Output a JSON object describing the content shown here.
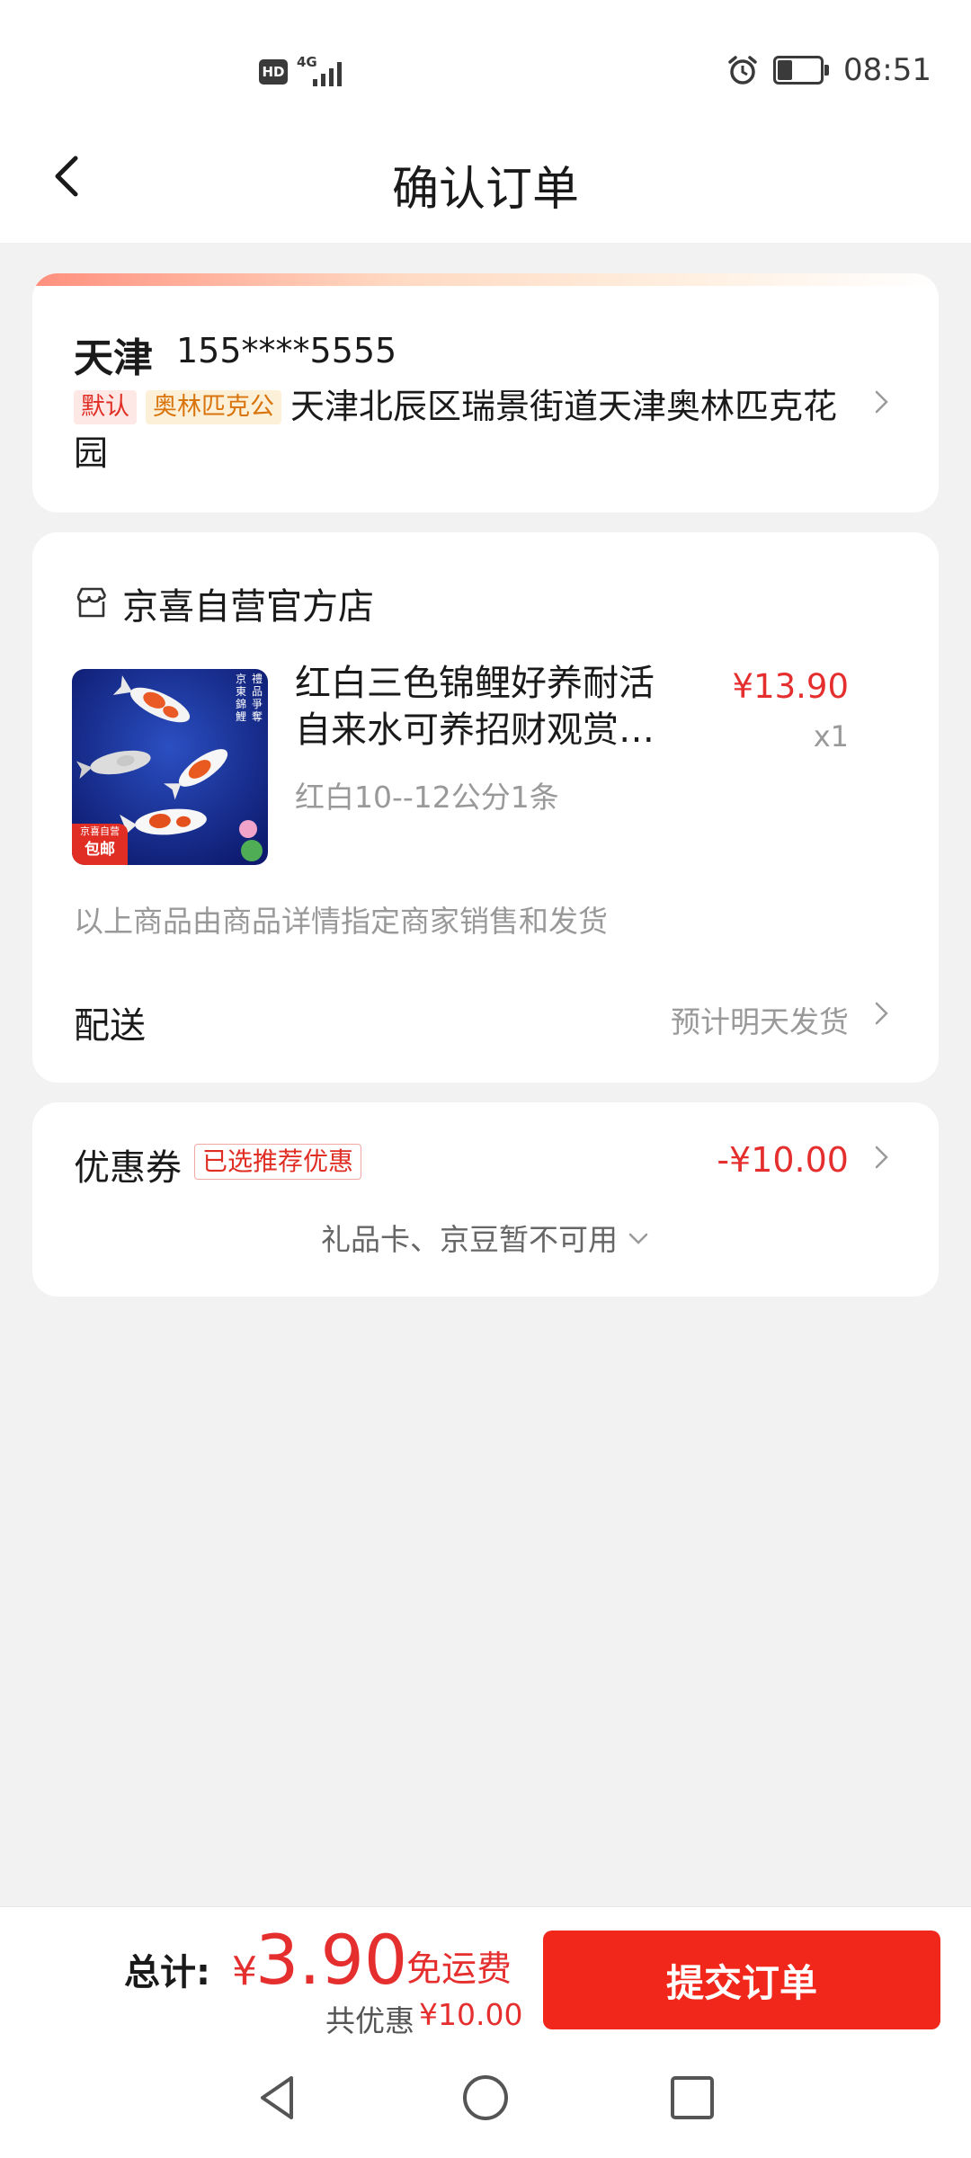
{
  "status_bar": {
    "hd": "HD",
    "network": "4G",
    "time": "08:51"
  },
  "header": {
    "title": "确认订单"
  },
  "address": {
    "city": "天津",
    "phone": "155****5555",
    "tag_default": "默认",
    "tag_label": "奥林匹克公",
    "detail": "天津北辰区瑞景街道天津奥林匹克花园"
  },
  "shop": {
    "name": "京喜自营官方店",
    "product": {
      "title": "红白三色锦鲤好养耐活自来水可养招财观赏…",
      "price": "¥13.90",
      "qty": "x1",
      "spec": "红白10--12公分1条",
      "badge_top": "京喜自营",
      "badge_bottom": "包邮",
      "image_caption_left": "京東錦鯉",
      "image_caption_right": "禮品爭奪"
    },
    "seller_note": "以上商品由商品详情指定商家销售和发货",
    "delivery_label": "配送",
    "delivery_value": "预计明天发货"
  },
  "coupon": {
    "label": "优惠券",
    "tag": "已选推荐优惠",
    "value": "-¥10.00",
    "gift_note": "礼品卡、京豆暂不可用"
  },
  "footer": {
    "total_label": "总计:",
    "currency": "¥",
    "total_value": "3.90",
    "shipping_note": "免运费",
    "saving_label": "共优惠",
    "saving_value": "¥10.00",
    "submit_label": "提交订单"
  },
  "colors": {
    "accent_red": "#e52e2e",
    "button_red": "#f2271c",
    "background": "#f2f2f2"
  }
}
